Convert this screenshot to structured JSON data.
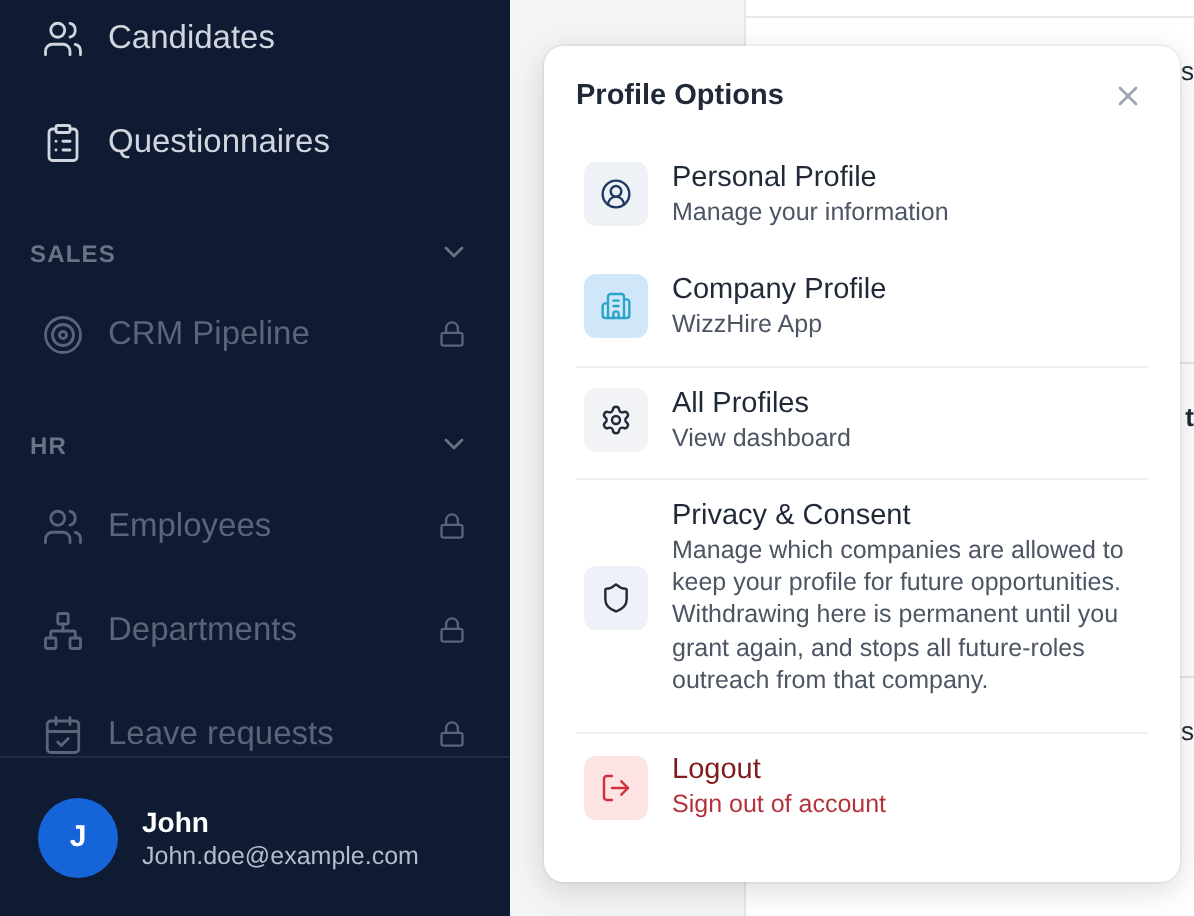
{
  "sidebar": {
    "items": [
      {
        "kind": "link",
        "label": "Candidates",
        "locked": false
      },
      {
        "kind": "link",
        "label": "Questionnaires",
        "locked": false
      },
      {
        "kind": "section",
        "label": "SALES",
        "expanded": true
      },
      {
        "kind": "link",
        "label": "CRM Pipeline",
        "locked": true
      },
      {
        "kind": "section",
        "label": "HR",
        "expanded": true
      },
      {
        "kind": "link",
        "label": "Employees",
        "locked": true
      },
      {
        "kind": "link",
        "label": "Departments",
        "locked": true
      },
      {
        "kind": "link",
        "label": "Leave requests",
        "locked": true
      }
    ],
    "user": {
      "initial": "J",
      "name": "John",
      "email": "John.doe@example.com"
    }
  },
  "page": {
    "texts": [
      "s",
      "t",
      "s"
    ]
  },
  "profile_menu": {
    "title": "Profile Options",
    "items": [
      {
        "kind": "personal",
        "title": "Personal Profile",
        "subtitle": "Manage your information",
        "divider_before": false
      },
      {
        "kind": "company",
        "title": "Company Profile",
        "subtitle": "WizzHire App",
        "divider_before": false
      },
      {
        "kind": "settings",
        "title": "All Profiles",
        "subtitle": "View dashboard",
        "divider_before": true
      },
      {
        "kind": "privacy",
        "title": "Privacy & Consent",
        "subtitle": "Manage which companies are allowed to keep your profile for future opportunities. Withdrawing here is permanent until you grant again, and stops all future-roles outreach from that company.",
        "divider_before": true
      },
      {
        "kind": "logout",
        "title": "Logout",
        "subtitle": "Sign out of account",
        "divider_before": true
      }
    ]
  }
}
